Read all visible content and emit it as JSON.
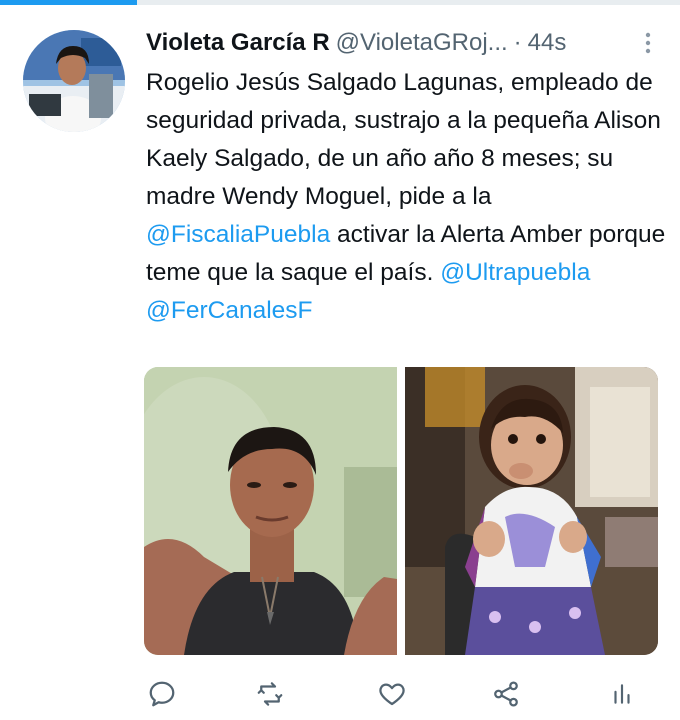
{
  "user": {
    "display_name": "Violeta García R",
    "handle": "@VioletaGRoj...",
    "separator": "·",
    "time": "44s"
  },
  "tweet": {
    "segments": [
      {
        "text": "Rogelio Jesús Salgado Lagunas, empleado de seguridad privada, sustrajo a la pequeña Alison Kaely Salgado, de un año año 8 meses; su madre Wendy Moguel, pide a la ",
        "type": "text"
      },
      {
        "text": "@FiscaliaPuebla",
        "type": "mention"
      },
      {
        "text": " activar la Alerta Amber porque teme que la saque el país. ",
        "type": "text"
      },
      {
        "text": "@Ultrapuebla",
        "type": "mention"
      },
      {
        "text": " @FerCanalesF",
        "type": "mention"
      }
    ]
  },
  "icons": {
    "more": "more-vertical-icon",
    "reply": "reply-icon",
    "retweet": "retweet-icon",
    "like": "heart-icon",
    "share": "share-icon",
    "analytics": "analytics-icon"
  },
  "colors": {
    "accent": "#1d9bf0",
    "text": "#0f1419",
    "secondary": "#536471"
  }
}
